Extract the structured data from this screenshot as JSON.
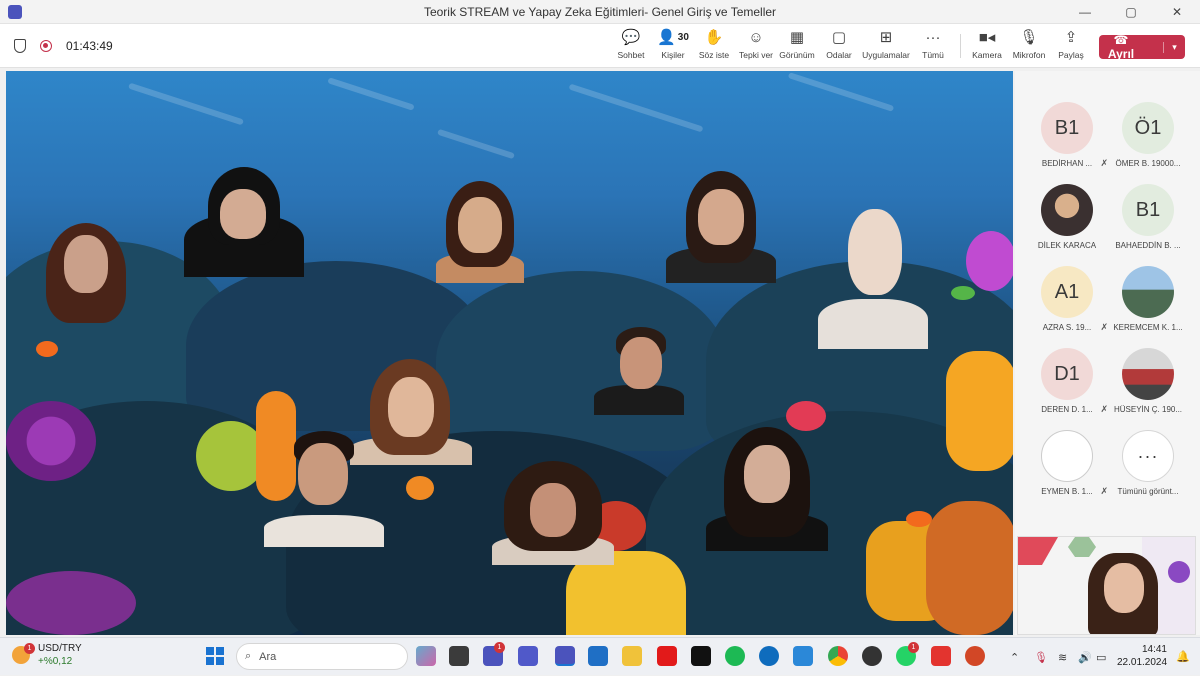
{
  "window": {
    "title": "Teorik STREAM ve Yapay Zeka Eğitimleri- Genel Giriş ve Temeller",
    "controls": [
      "—",
      "▢",
      "✕"
    ]
  },
  "toolbar": {
    "timer": "01:43:49",
    "buttons": [
      {
        "label": "Sohbet",
        "icon": "chat-icon"
      },
      {
        "label": "Kişiler",
        "icon": "people-icon",
        "count": "30"
      },
      {
        "label": "Söz iste",
        "icon": "raise-hand-icon"
      },
      {
        "label": "Tepki ver",
        "icon": "react-icon"
      },
      {
        "label": "Görünüm",
        "icon": "view-icon"
      },
      {
        "label": "Odalar",
        "icon": "rooms-icon"
      },
      {
        "label": "Uygulamalar",
        "icon": "apps-icon"
      },
      {
        "label": "Tümü",
        "icon": "more-icon"
      },
      {
        "label": "Kamera",
        "icon": "camera-icon"
      },
      {
        "label": "Mikrofon",
        "icon": "mic-icon"
      },
      {
        "label": "Paylaş",
        "icon": "share-icon"
      }
    ],
    "leave_label": "Ayrıl",
    "leave_color": "#c4314b"
  },
  "participants": [
    {
      "initials": "B1",
      "name": "BEDİRHAN ...",
      "muted": true
    },
    {
      "initials": "Ö1",
      "name": "ÖMER B. 19000...",
      "muted": false
    },
    {
      "initials": "",
      "name": "DİLEK KARACA",
      "muted": false
    },
    {
      "initials": "B1",
      "name": "BAHAEDDİN B. ...",
      "muted": false
    },
    {
      "initials": "A1",
      "name": "AZRA S. 19...",
      "muted": true
    },
    {
      "initials": "",
      "name": "KEREMCEM K. 1...",
      "muted": false
    },
    {
      "initials": "D1",
      "name": "DEREN D. 1...",
      "muted": true
    },
    {
      "initials": "",
      "name": "HÜSEYİN Ç. 190...",
      "muted": false
    },
    {
      "initials": "",
      "name": "EYMEN B. 1...",
      "muted": true
    },
    {
      "initials": "···",
      "name": "Tümünü görünt...",
      "muted": false
    }
  ],
  "taskbar": {
    "weather_badge": "1",
    "ticker": "USD/TRY",
    "ticker_change": "+%0,12",
    "search_placeholder": "Ara",
    "teams_badge": "1",
    "whatsapp_badge": "1",
    "time": "14:41",
    "date": "22.01.2024"
  }
}
